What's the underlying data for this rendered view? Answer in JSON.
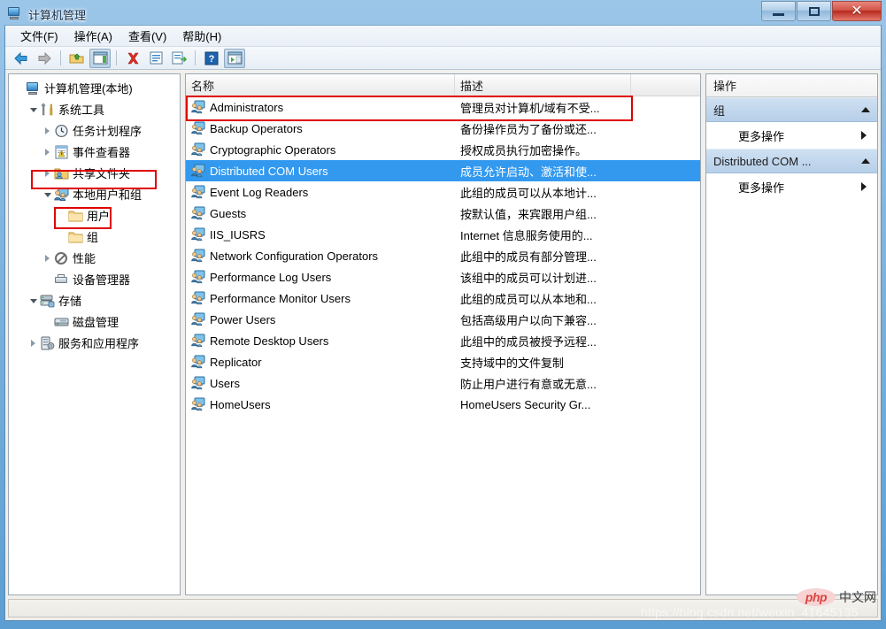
{
  "window": {
    "title": "计算机管理",
    "title_icon": "computer-management-icon",
    "minimize_label": "最小化",
    "maximize_label": "最大化",
    "close_label": "关闭"
  },
  "menubar": {
    "items": [
      {
        "label": "文件(F)",
        "name": "menu-file"
      },
      {
        "label": "操作(A)",
        "name": "menu-action"
      },
      {
        "label": "查看(V)",
        "name": "menu-view"
      },
      {
        "label": "帮助(H)",
        "name": "menu-help"
      }
    ]
  },
  "toolbar": {
    "buttons": [
      {
        "icon": "back-arrow-icon"
      },
      {
        "icon": "forward-arrow-icon"
      },
      {
        "icon": "up-folder-icon"
      },
      {
        "icon": "show-hide-tree-icon"
      },
      {
        "icon": "delete-icon"
      },
      {
        "icon": "properties-icon"
      },
      {
        "icon": "export-list-icon"
      },
      {
        "icon": "help-icon"
      },
      {
        "icon": "show-action-pane-icon"
      }
    ]
  },
  "tree": {
    "items": [
      {
        "label": "计算机管理(本地)",
        "indent": 0,
        "expander": "none",
        "icon": "computer-icon",
        "name": "tree-item-computer-management"
      },
      {
        "label": "系统工具",
        "indent": 1,
        "expander": "expanded",
        "icon": "system-tools-icon",
        "name": "tree-item-system-tools"
      },
      {
        "label": "任务计划程序",
        "indent": 2,
        "expander": "collapsed",
        "icon": "task-scheduler-icon",
        "name": "tree-item-task-scheduler"
      },
      {
        "label": "事件查看器",
        "indent": 2,
        "expander": "collapsed",
        "icon": "event-viewer-icon",
        "name": "tree-item-event-viewer"
      },
      {
        "label": "共享文件夹",
        "indent": 2,
        "expander": "collapsed",
        "icon": "shared-folders-icon",
        "name": "tree-item-shared-folders"
      },
      {
        "label": "本地用户和组",
        "indent": 2,
        "expander": "expanded",
        "icon": "local-users-groups-icon",
        "name": "tree-item-local-users-and-groups"
      },
      {
        "label": "用户",
        "indent": 3,
        "expander": "none",
        "icon": "folder-icon",
        "name": "tree-item-users"
      },
      {
        "label": "组",
        "indent": 3,
        "expander": "none",
        "icon": "folder-icon",
        "name": "tree-item-groups"
      },
      {
        "label": "性能",
        "indent": 2,
        "expander": "collapsed",
        "icon": "performance-icon",
        "name": "tree-item-performance"
      },
      {
        "label": "设备管理器",
        "indent": 2,
        "expander": "none",
        "icon": "device-manager-icon",
        "name": "tree-item-device-manager"
      },
      {
        "label": "存储",
        "indent": 1,
        "expander": "expanded",
        "icon": "storage-icon",
        "name": "tree-item-storage"
      },
      {
        "label": "磁盘管理",
        "indent": 2,
        "expander": "none",
        "icon": "disk-management-icon",
        "name": "tree-item-disk-management"
      },
      {
        "label": "服务和应用程序",
        "indent": 1,
        "expander": "collapsed",
        "icon": "services-applications-icon",
        "name": "tree-item-services-and-applications"
      }
    ]
  },
  "list": {
    "columns": [
      {
        "label": "名称",
        "name": "column-header-name"
      },
      {
        "label": "描述",
        "name": "column-header-description"
      },
      {
        "label": "",
        "name": "column-header-empty"
      }
    ],
    "rows": [
      {
        "name": "Administrators",
        "description": "管理员对计算机/域有不受...",
        "selected": false
      },
      {
        "name": "Backup Operators",
        "description": "备份操作员为了备份或还...",
        "selected": false
      },
      {
        "name": "Cryptographic Operators",
        "description": "授权成员执行加密操作。",
        "selected": false
      },
      {
        "name": "Distributed COM Users",
        "description": "成员允许启动、激活和使...",
        "selected": true
      },
      {
        "name": "Event Log Readers",
        "description": "此组的成员可以从本地计...",
        "selected": false
      },
      {
        "name": "Guests",
        "description": "按默认值，来宾跟用户组...",
        "selected": false
      },
      {
        "name": "IIS_IUSRS",
        "description": "Internet 信息服务使用的...",
        "selected": false
      },
      {
        "name": "Network Configuration Operators",
        "description": "此组中的成员有部分管理...",
        "selected": false
      },
      {
        "name": "Performance Log Users",
        "description": "该组中的成员可以计划进...",
        "selected": false
      },
      {
        "name": "Performance Monitor Users",
        "description": "此组的成员可以从本地和...",
        "selected": false
      },
      {
        "name": "Power Users",
        "description": "包括高级用户以向下兼容...",
        "selected": false
      },
      {
        "name": "Remote Desktop Users",
        "description": "此组中的成员被授予远程...",
        "selected": false
      },
      {
        "name": "Replicator",
        "description": "支持域中的文件复制",
        "selected": false
      },
      {
        "name": "Users",
        "description": "防止用户进行有意或无意...",
        "selected": false
      },
      {
        "name": "HomeUsers",
        "description": "HomeUsers Security Gr...",
        "selected": false
      }
    ]
  },
  "actions": {
    "title": "操作",
    "sections": [
      {
        "header": "组",
        "item": "更多操作",
        "name": "actions-section-groups"
      },
      {
        "header": "Distributed COM ...",
        "item": "更多操作",
        "name": "actions-section-selected-item"
      }
    ]
  },
  "watermarks": {
    "url": "https://blog.csdn.net/weixin_41645135",
    "php_badge": "php",
    "php_text": "中文网"
  },
  "colors": {
    "selection_blue": "#3399ef",
    "annotation_red": "#e00000",
    "close_button_red": "#b8291e",
    "section_header_blue": "#b6cfe8"
  }
}
